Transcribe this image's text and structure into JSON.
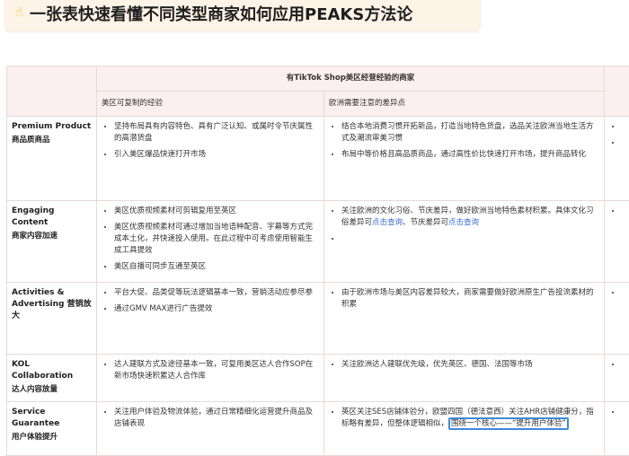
{
  "banner": {
    "icon": "pointing-hand-icon",
    "title": "一张表快速看懂不同类型商家如何应用PEAKS方法论"
  },
  "table": {
    "group_header": "有TikTok Shop美区经营经验的商家",
    "col_headers": [
      "美区可复制的经验",
      "欧洲需要注意的差异点"
    ],
    "rows": [
      {
        "en": "Premium Product",
        "zh": "商品质商品",
        "us": [
          "坚持布局具有内容特色、具有广泛认知、或属时令节庆属性的高潜货盘",
          "引入美区爆品快速打开市场"
        ],
        "eu": [
          "结合本地消费习惯开拓新品，打造当地特色货盘，选品关注欧洲当地生活方式及潮流审美习惯",
          "布局中等价格且高品质商品，通过高性价比快速打开市场，提升商品转化"
        ]
      },
      {
        "en": "Engaging Content",
        "zh": "商家内容加速",
        "us": [
          "美区优质视频素材可剪辑复用至英区",
          "美区优质视频素材可通过增加当地语种配音、字幕等方式完成本土化，并快速投入使用。在此过程中可考虑使用智能生成工具提效",
          "美区自播可同步互通至英区"
        ],
        "eu_text": "关注欧洲的文化习俗、节庆差异，做好欧洲当地特色素材积累。具体文化习俗差异可",
        "eu_link1": "点击查询",
        "eu_mid": "、节庆差异可",
        "eu_link2": "点击查询"
      },
      {
        "en": "Activities & Advertising",
        "zh": "营销放大",
        "us": [
          "平台大促、品类促等玩法逻辑基本一致，营销活动应参尽参",
          "通过GMV MAX进行广告提效"
        ],
        "eu": [
          "由于欧洲市场与美区内容差异较大，商家需要做好欧洲原生广告投流素材的积累"
        ]
      },
      {
        "en": "KOL Collaboration",
        "zh": "达人内容放量",
        "us": [
          "达人建联方式及途径基本一致，可复用美区达人合作SOP在新市场快速积累达人合作库"
        ],
        "eu": [
          "关注欧洲达人建联优先级，优先英区、德国、法国等市场"
        ]
      },
      {
        "en": "Service Guarantee",
        "zh": "用户体验提升",
        "us": [
          "关注用户体验及物流体验，通过日常精细化运营提升商品及店铺表现"
        ],
        "eu_text": "英区关注SES店铺体验分，欧盟四国（德法意西）关注AHR店铺健康分，指标略有差异，但整体逻辑相似，",
        "eu_highlight": "围绕一个核心——“提升用户体验”"
      }
    ]
  }
}
